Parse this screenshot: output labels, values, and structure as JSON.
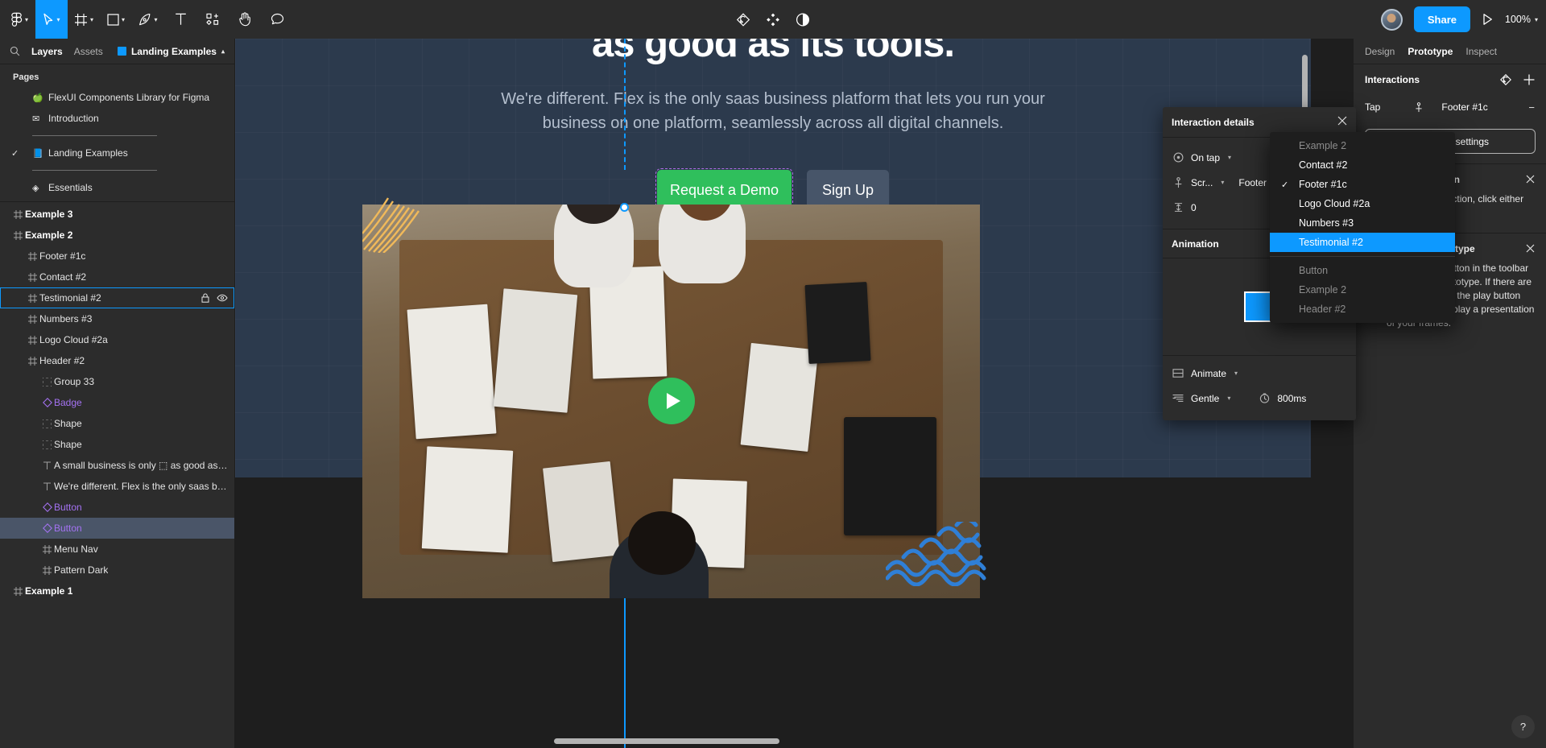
{
  "toolbar": {
    "menu_label": "Figma menu",
    "tools": [
      {
        "name": "figma-menu",
        "icon": "figma-logo",
        "caret": true,
        "active": false
      },
      {
        "name": "move-tool",
        "icon": "cursor-arrow",
        "caret": true,
        "active": true
      },
      {
        "name": "frame-tool",
        "icon": "frame",
        "caret": true,
        "active": false
      },
      {
        "name": "shape-tool",
        "icon": "square",
        "caret": true,
        "active": false
      },
      {
        "name": "pen-tool",
        "icon": "pen",
        "caret": true,
        "active": false
      },
      {
        "name": "text-tool",
        "icon": "text-T",
        "caret": false,
        "active": false
      },
      {
        "name": "resources-tool",
        "icon": "components-plus",
        "caret": false,
        "active": false
      },
      {
        "name": "hand-tool",
        "icon": "hand",
        "caret": false,
        "active": false
      },
      {
        "name": "comment-tool",
        "icon": "comment-bubble",
        "caret": false,
        "active": false
      }
    ],
    "center_icons": [
      "prototype-connection-icon",
      "components-icon",
      "mask-contrast-icon"
    ],
    "share_label": "Share",
    "zoom_label": "100%"
  },
  "left_panel": {
    "tabs": [
      {
        "label": "Layers",
        "active": true
      },
      {
        "label": "Assets",
        "active": false
      }
    ],
    "file_name": "Landing Examples",
    "pages_header": "Pages",
    "pages": [
      {
        "label": "FlexUI Components Library for Figma",
        "emoji": "🍏",
        "checked": false,
        "divider_after": false
      },
      {
        "label": "Introduction",
        "emoji": "✉",
        "checked": false,
        "divider_after": true
      },
      {
        "label": "Landing Examples",
        "emoji": "📘",
        "checked": true,
        "divider_after": true
      },
      {
        "label": "Essentials",
        "emoji": "◈",
        "checked": false,
        "divider_after": false
      }
    ],
    "layers": [
      {
        "label": "Example 3",
        "icon": "frame",
        "indent": 0,
        "bold": true,
        "state": "none",
        "component": false
      },
      {
        "label": "Example 2",
        "icon": "frame",
        "indent": 0,
        "bold": true,
        "state": "none",
        "component": false
      },
      {
        "label": "Footer #1c",
        "icon": "frame",
        "indent": 1,
        "bold": false,
        "state": "none",
        "component": false
      },
      {
        "label": "Contact #2",
        "icon": "frame",
        "indent": 1,
        "bold": false,
        "state": "none",
        "component": false
      },
      {
        "label": "Testimonial #2",
        "icon": "frame",
        "indent": 1,
        "bold": false,
        "state": "outline",
        "component": false,
        "lock_icon": true,
        "eye_icon": true
      },
      {
        "label": "Numbers #3",
        "icon": "frame",
        "indent": 1,
        "bold": false,
        "state": "none",
        "component": false
      },
      {
        "label": "Logo Cloud #2a",
        "icon": "frame",
        "indent": 1,
        "bold": false,
        "state": "none",
        "component": false
      },
      {
        "label": "Header #2",
        "icon": "frame",
        "indent": 1,
        "bold": false,
        "state": "none",
        "component": false
      },
      {
        "label": "Group 33",
        "icon": "group",
        "indent": 2,
        "bold": false,
        "state": "none",
        "component": false
      },
      {
        "label": "Badge",
        "icon": "component-diamond",
        "indent": 2,
        "bold": false,
        "state": "none",
        "component": true
      },
      {
        "label": "Shape",
        "icon": "group",
        "indent": 2,
        "bold": false,
        "state": "none",
        "component": false
      },
      {
        "label": "Shape",
        "icon": "group",
        "indent": 2,
        "bold": false,
        "state": "none",
        "component": false
      },
      {
        "label": "A small business is only ⬚ as good as its tools.",
        "icon": "text",
        "indent": 2,
        "bold": false,
        "state": "none",
        "component": false
      },
      {
        "label": "We're different. Flex is the only saas business pl...",
        "icon": "text",
        "indent": 2,
        "bold": false,
        "state": "none",
        "component": false
      },
      {
        "label": "Button",
        "icon": "component-diamond",
        "indent": 2,
        "bold": false,
        "state": "none",
        "component": true
      },
      {
        "label": "Button",
        "icon": "component-diamond",
        "indent": 2,
        "bold": false,
        "state": "fill",
        "component": true
      },
      {
        "label": "Menu Nav",
        "icon": "frame",
        "indent": 2,
        "bold": false,
        "state": "none",
        "component": false
      },
      {
        "label": "Pattern Dark",
        "icon": "frame",
        "indent": 2,
        "bold": false,
        "state": "none",
        "component": false
      },
      {
        "label": "Example 1",
        "icon": "frame",
        "indent": 0,
        "bold": true,
        "state": "none",
        "component": false
      }
    ]
  },
  "canvas": {
    "headline": "as good as its tools.",
    "subheadline": "We're different. Flex is the only saas business platform that lets you run your business on one platform, seamlessly across all digital channels.",
    "primary_button": "Request a Demo",
    "secondary_button": "Sign Up",
    "play_overlay": "play-video-button",
    "accent_green": "#2fbf5c",
    "accent_blue": "#0d99ff",
    "frame_bg": "#2c3a4d"
  },
  "interaction_details": {
    "title": "Interaction details",
    "trigger_label": "On tap",
    "action_label": "Scr...",
    "action_target": "Footer",
    "offset_value": "0",
    "animation_header": "Animation",
    "animation_type": "Animate",
    "easing": "Gentle",
    "duration": "800ms"
  },
  "dropdown": {
    "groups": [
      {
        "items": [
          {
            "label": "Example 2",
            "dim": true,
            "checked": false,
            "highlighted": false
          },
          {
            "label": "Contact #2",
            "dim": false,
            "checked": false,
            "highlighted": false
          },
          {
            "label": "Footer #1c",
            "dim": false,
            "checked": true,
            "highlighted": false
          },
          {
            "label": "Logo Cloud #2a",
            "dim": false,
            "checked": false,
            "highlighted": false
          },
          {
            "label": "Numbers #3",
            "dim": false,
            "checked": false,
            "highlighted": false
          },
          {
            "label": "Testimonial #2",
            "dim": false,
            "checked": false,
            "highlighted": true
          }
        ]
      },
      {
        "items": [
          {
            "label": "Button",
            "dim": true,
            "checked": false,
            "highlighted": false
          },
          {
            "label": "Example 2",
            "dim": true,
            "checked": false,
            "highlighted": false
          },
          {
            "label": "Header #2",
            "dim": true,
            "checked": false,
            "highlighted": false
          }
        ]
      }
    ]
  },
  "right_panel": {
    "tabs": [
      {
        "label": "Design",
        "active": false
      },
      {
        "label": "Prototype",
        "active": true
      },
      {
        "label": "Inspect",
        "active": false
      }
    ],
    "interactions_header": "Interactions",
    "interaction_rows": [
      {
        "trigger": "Tap",
        "target": "Footer #1c"
      }
    ],
    "prototype_settings_label": "Prototype settings",
    "tips": [
      {
        "title": "Editing a connection",
        "body": "To edit a connection, click either end.",
        "icon": "connection-icon"
      },
      {
        "title": "Running your prototype",
        "body": "Use the play button in the toolbar to play your prototype. If there are no connections, the play button can be used to play a presentation of your frames.",
        "icon": "play-icon"
      }
    ],
    "help_label": "?"
  }
}
